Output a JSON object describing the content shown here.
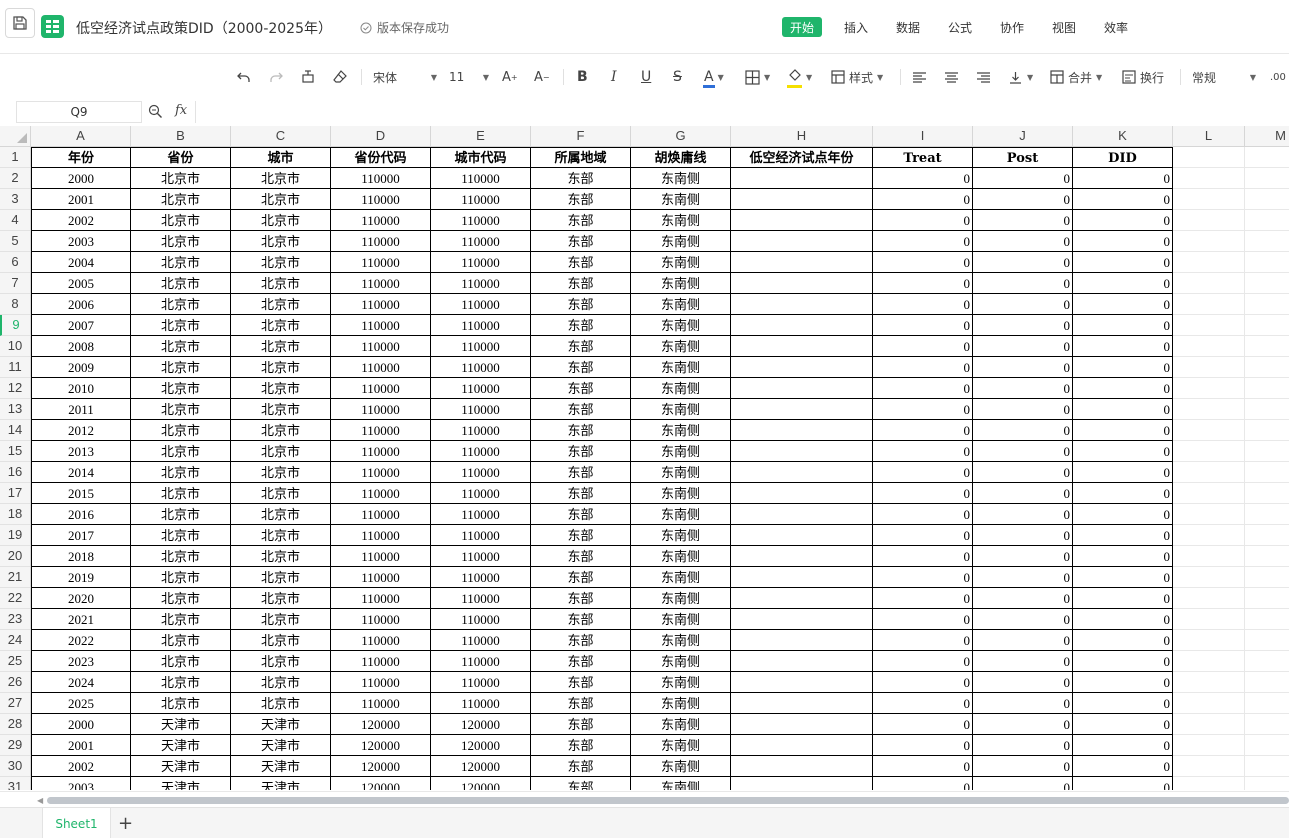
{
  "titlebar": {
    "title": "低空经济试点政策DID（2000-2025年）",
    "save_status": "版本保存成功",
    "menus": [
      "开始",
      "插入",
      "数据",
      "公式",
      "协作",
      "视图",
      "效率"
    ],
    "active_menu": "开始"
  },
  "toolbar": {
    "font_name": "宋体",
    "font_size": "11",
    "style_label": "样式",
    "merge_label": "合并",
    "wrap_label": "换行",
    "number_format": "常规",
    "decimal_label": ".00"
  },
  "formula_bar": {
    "cell_ref": "Q9",
    "fx_label": "fx",
    "formula": ""
  },
  "grid": {
    "columns": [
      "A",
      "B",
      "C",
      "D",
      "E",
      "F",
      "G",
      "H",
      "I",
      "J",
      "K",
      "L",
      "M"
    ],
    "headers": [
      "年份",
      "省份",
      "城市",
      "省份代码",
      "城市代码",
      "所属地域",
      "胡焕庸线",
      "低空经济试点年份",
      "Treat",
      "Post",
      "DID"
    ],
    "row_numbers": [
      "1",
      "2",
      "3",
      "4",
      "5",
      "6",
      "7",
      "8",
      "9",
      "10",
      "11",
      "12",
      "13",
      "14",
      "15",
      "16",
      "17",
      "18",
      "19",
      "20",
      "21",
      "22",
      "23",
      "24",
      "25",
      "26",
      "27",
      "28",
      "29",
      "30",
      "31"
    ],
    "rows": [
      [
        "2000",
        "北京市",
        "北京市",
        "110000",
        "110000",
        "东部",
        "东南侧",
        "",
        "0",
        "0",
        "0"
      ],
      [
        "2001",
        "北京市",
        "北京市",
        "110000",
        "110000",
        "东部",
        "东南侧",
        "",
        "0",
        "0",
        "0"
      ],
      [
        "2002",
        "北京市",
        "北京市",
        "110000",
        "110000",
        "东部",
        "东南侧",
        "",
        "0",
        "0",
        "0"
      ],
      [
        "2003",
        "北京市",
        "北京市",
        "110000",
        "110000",
        "东部",
        "东南侧",
        "",
        "0",
        "0",
        "0"
      ],
      [
        "2004",
        "北京市",
        "北京市",
        "110000",
        "110000",
        "东部",
        "东南侧",
        "",
        "0",
        "0",
        "0"
      ],
      [
        "2005",
        "北京市",
        "北京市",
        "110000",
        "110000",
        "东部",
        "东南侧",
        "",
        "0",
        "0",
        "0"
      ],
      [
        "2006",
        "北京市",
        "北京市",
        "110000",
        "110000",
        "东部",
        "东南侧",
        "",
        "0",
        "0",
        "0"
      ],
      [
        "2007",
        "北京市",
        "北京市",
        "110000",
        "110000",
        "东部",
        "东南侧",
        "",
        "0",
        "0",
        "0"
      ],
      [
        "2008",
        "北京市",
        "北京市",
        "110000",
        "110000",
        "东部",
        "东南侧",
        "",
        "0",
        "0",
        "0"
      ],
      [
        "2009",
        "北京市",
        "北京市",
        "110000",
        "110000",
        "东部",
        "东南侧",
        "",
        "0",
        "0",
        "0"
      ],
      [
        "2010",
        "北京市",
        "北京市",
        "110000",
        "110000",
        "东部",
        "东南侧",
        "",
        "0",
        "0",
        "0"
      ],
      [
        "2011",
        "北京市",
        "北京市",
        "110000",
        "110000",
        "东部",
        "东南侧",
        "",
        "0",
        "0",
        "0"
      ],
      [
        "2012",
        "北京市",
        "北京市",
        "110000",
        "110000",
        "东部",
        "东南侧",
        "",
        "0",
        "0",
        "0"
      ],
      [
        "2013",
        "北京市",
        "北京市",
        "110000",
        "110000",
        "东部",
        "东南侧",
        "",
        "0",
        "0",
        "0"
      ],
      [
        "2014",
        "北京市",
        "北京市",
        "110000",
        "110000",
        "东部",
        "东南侧",
        "",
        "0",
        "0",
        "0"
      ],
      [
        "2015",
        "北京市",
        "北京市",
        "110000",
        "110000",
        "东部",
        "东南侧",
        "",
        "0",
        "0",
        "0"
      ],
      [
        "2016",
        "北京市",
        "北京市",
        "110000",
        "110000",
        "东部",
        "东南侧",
        "",
        "0",
        "0",
        "0"
      ],
      [
        "2017",
        "北京市",
        "北京市",
        "110000",
        "110000",
        "东部",
        "东南侧",
        "",
        "0",
        "0",
        "0"
      ],
      [
        "2018",
        "北京市",
        "北京市",
        "110000",
        "110000",
        "东部",
        "东南侧",
        "",
        "0",
        "0",
        "0"
      ],
      [
        "2019",
        "北京市",
        "北京市",
        "110000",
        "110000",
        "东部",
        "东南侧",
        "",
        "0",
        "0",
        "0"
      ],
      [
        "2020",
        "北京市",
        "北京市",
        "110000",
        "110000",
        "东部",
        "东南侧",
        "",
        "0",
        "0",
        "0"
      ],
      [
        "2021",
        "北京市",
        "北京市",
        "110000",
        "110000",
        "东部",
        "东南侧",
        "",
        "0",
        "0",
        "0"
      ],
      [
        "2022",
        "北京市",
        "北京市",
        "110000",
        "110000",
        "东部",
        "东南侧",
        "",
        "0",
        "0",
        "0"
      ],
      [
        "2023",
        "北京市",
        "北京市",
        "110000",
        "110000",
        "东部",
        "东南侧",
        "",
        "0",
        "0",
        "0"
      ],
      [
        "2024",
        "北京市",
        "北京市",
        "110000",
        "110000",
        "东部",
        "东南侧",
        "",
        "0",
        "0",
        "0"
      ],
      [
        "2025",
        "北京市",
        "北京市",
        "110000",
        "110000",
        "东部",
        "东南侧",
        "",
        "0",
        "0",
        "0"
      ],
      [
        "2000",
        "天津市",
        "天津市",
        "120000",
        "120000",
        "东部",
        "东南侧",
        "",
        "0",
        "0",
        "0"
      ],
      [
        "2001",
        "天津市",
        "天津市",
        "120000",
        "120000",
        "东部",
        "东南侧",
        "",
        "0",
        "0",
        "0"
      ],
      [
        "2002",
        "天津市",
        "天津市",
        "120000",
        "120000",
        "东部",
        "东南侧",
        "",
        "0",
        "0",
        "0"
      ],
      [
        "2003",
        "天津市",
        "天津市",
        "120000",
        "120000",
        "东部",
        "东南侧",
        "",
        "0",
        "0",
        "0"
      ]
    ],
    "active_row": "9"
  },
  "sheets": {
    "tabs": [
      "Sheet1"
    ],
    "active": "Sheet1",
    "add_label": "+"
  },
  "colors": {
    "accent": "#1fb56b",
    "font_color_bar": "#2f6fd8",
    "fill_color_bar": "#f5e000"
  }
}
